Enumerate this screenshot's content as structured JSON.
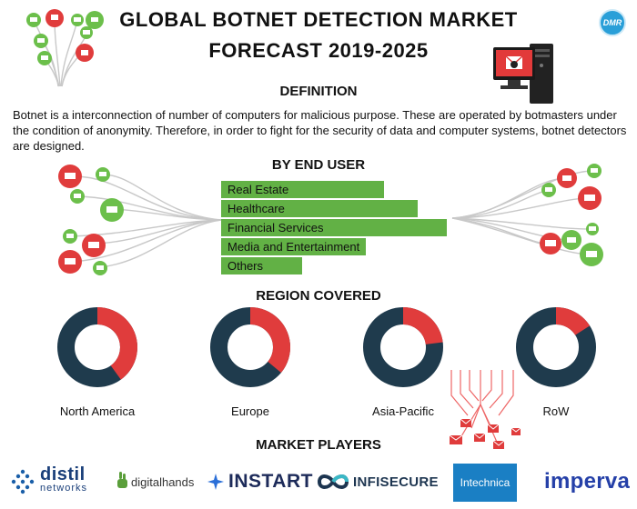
{
  "header": {
    "title_line1": "GLOBAL BOTNET DETECTION MARKET",
    "title_line2": "FORECAST 2019-2025",
    "badge": "DMR"
  },
  "definition": {
    "heading": "DEFINITION",
    "text": "Botnet is a interconnection of number of computers for malicious purpose. These are operated by botmasters under the condition of anonymity. Therefore, in order to fight for the security of data and computer systems, botnet detectors are designed."
  },
  "end_user": {
    "heading": "BY END USER"
  },
  "region": {
    "heading": "REGION COVERED"
  },
  "players": {
    "heading": "MARKET PLAYERS",
    "logos": [
      "distil",
      "networks",
      "digitalhands",
      "INSTART",
      "INFISECURE",
      "Intechnica",
      "imperva"
    ]
  },
  "colors": {
    "bar_green": "#62b145",
    "donut_dark": "#1f3b4d",
    "donut_red": "#e03c3c",
    "node_green": "#6cbf4b",
    "node_red": "#e03c3c",
    "intechnica_blue": "#1a7fc4",
    "imperva_blue": "#2540a8",
    "badge_blue": "#2a9fd8"
  },
  "icons": [
    "computer-network-icon",
    "hacked-computer-icon",
    "email-network-icon",
    "dmr-logo-icon"
  ],
  "chart_data": [
    {
      "type": "bar",
      "orientation": "horizontal",
      "categories": [
        "Real Estate",
        "Healthcare",
        "Financial Services",
        "Media and Entertainment",
        "Others"
      ],
      "values": [
        0.72,
        0.87,
        1.0,
        0.64,
        0.36
      ],
      "grid": false
    },
    {
      "type": "pie",
      "style": "donut",
      "categories": [
        "North America",
        "Europe",
        "Asia-Pacific",
        "RoW"
      ],
      "values": [
        0.4,
        0.36,
        0.23,
        0.16
      ]
    }
  ]
}
